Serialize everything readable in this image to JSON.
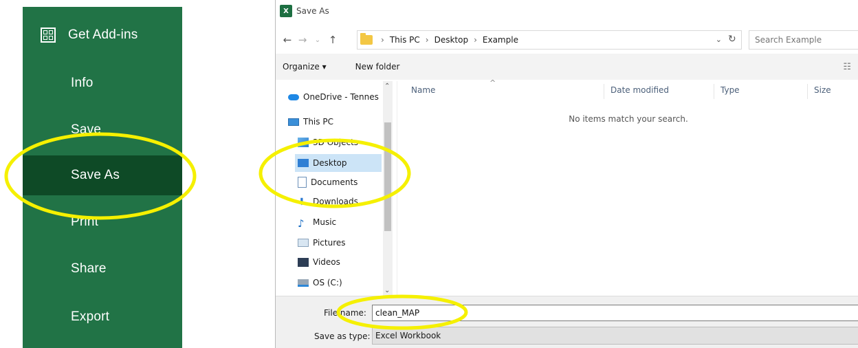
{
  "backstage": {
    "items": [
      {
        "label": "Get Add-ins",
        "icon": "add-ins-icon"
      },
      {
        "label": "Info"
      },
      {
        "label": "Save"
      },
      {
        "label": "Save As",
        "selected": true
      },
      {
        "label": "Print"
      },
      {
        "label": "Share"
      },
      {
        "label": "Export"
      }
    ],
    "bg_color": "#217346",
    "selected_color": "#0e4a26"
  },
  "dialog": {
    "title": "Save As",
    "app_icon_label": "X",
    "nav_back_icon": "back-arrow-icon",
    "nav_forward_icon": "forward-arrow-icon",
    "nav_up_icon": "up-arrow-icon",
    "address": [
      "This PC",
      "Desktop",
      "Example"
    ],
    "search_placeholder": "Search Example",
    "toolbar": {
      "organize": "Organize ▾",
      "new_folder": "New folder"
    },
    "nav_items": [
      {
        "label": "OneDrive - Tennes",
        "icon": "cloud-icon"
      },
      {
        "label": "This PC",
        "icon": "pc-icon"
      },
      {
        "label": "3D Objects",
        "icon": "3d-objects-icon"
      },
      {
        "label": "Desktop",
        "icon": "desktop-icon",
        "selected": true
      },
      {
        "label": "Documents",
        "icon": "documents-icon"
      },
      {
        "label": "Downloads",
        "icon": "downloads-icon"
      },
      {
        "label": "Music",
        "icon": "music-icon"
      },
      {
        "label": "Pictures",
        "icon": "pictures-icon"
      },
      {
        "label": "Videos",
        "icon": "videos-icon"
      },
      {
        "label": "OS (C:)",
        "icon": "drive-icon"
      }
    ],
    "columns": [
      "Name",
      "Date modified",
      "Type",
      "Size"
    ],
    "empty_message": "No items match your search.",
    "file_name_label": "File name:",
    "file_name_value": "clean_MAP",
    "save_type_label": "Save as type:",
    "save_type_value": "Excel Workbook"
  },
  "annotation_color": "#f5f000"
}
